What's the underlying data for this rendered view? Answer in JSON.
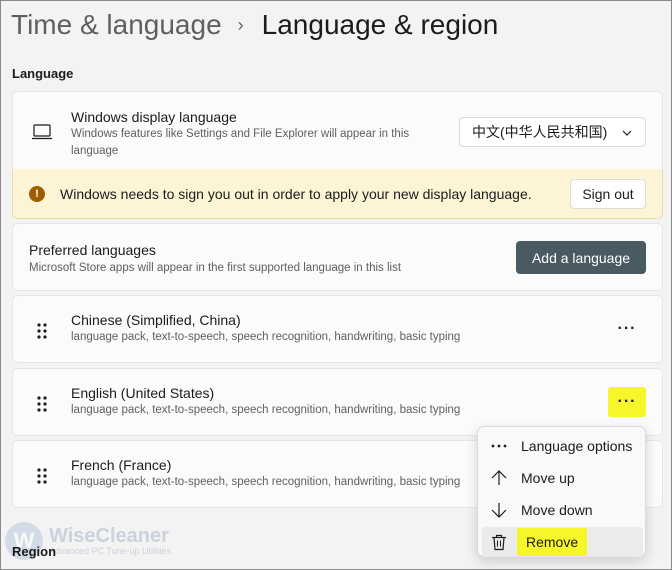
{
  "breadcrumb": {
    "parent": "Time & language",
    "current": "Language & region"
  },
  "language_section": {
    "title": "Language"
  },
  "display_language": {
    "title": "Windows display language",
    "description": "Windows features like Settings and File Explorer will appear in this language",
    "selected": "中文(中华人民共和国)"
  },
  "warning": {
    "text": "Windows needs to sign you out in order to apply your new display language.",
    "button": "Sign out"
  },
  "preferred": {
    "title": "Preferred languages",
    "description": "Microsoft Store apps will appear in the first supported language in this list",
    "add_button": "Add a language"
  },
  "languages": [
    {
      "name": "Chinese (Simplified, China)",
      "features": "language pack, text-to-speech, speech recognition, handwriting, basic typing"
    },
    {
      "name": "English (United States)",
      "features": "language pack, text-to-speech, speech recognition, handwriting, basic typing"
    },
    {
      "name": "French (France)",
      "features": "language pack, text-to-speech, speech recognition, handwriting, basic typing"
    }
  ],
  "more_label": "···",
  "context_menu": {
    "items": [
      {
        "label": "Language options",
        "icon": "more-horizontal-icon"
      },
      {
        "label": "Move up",
        "icon": "arrow-up-icon"
      },
      {
        "label": "Move down",
        "icon": "arrow-down-icon"
      },
      {
        "label": "Remove",
        "icon": "trash-icon"
      }
    ]
  },
  "region_section": {
    "title": "Region"
  },
  "watermark": {
    "logo": "W",
    "title": "WiseCleaner",
    "subtitle": "Advanced PC Tune-up Utilities"
  },
  "colors": {
    "highlight": "#f7f62a",
    "warning_bg": "#fcf4d5",
    "primary_button": "#4a5a63"
  }
}
